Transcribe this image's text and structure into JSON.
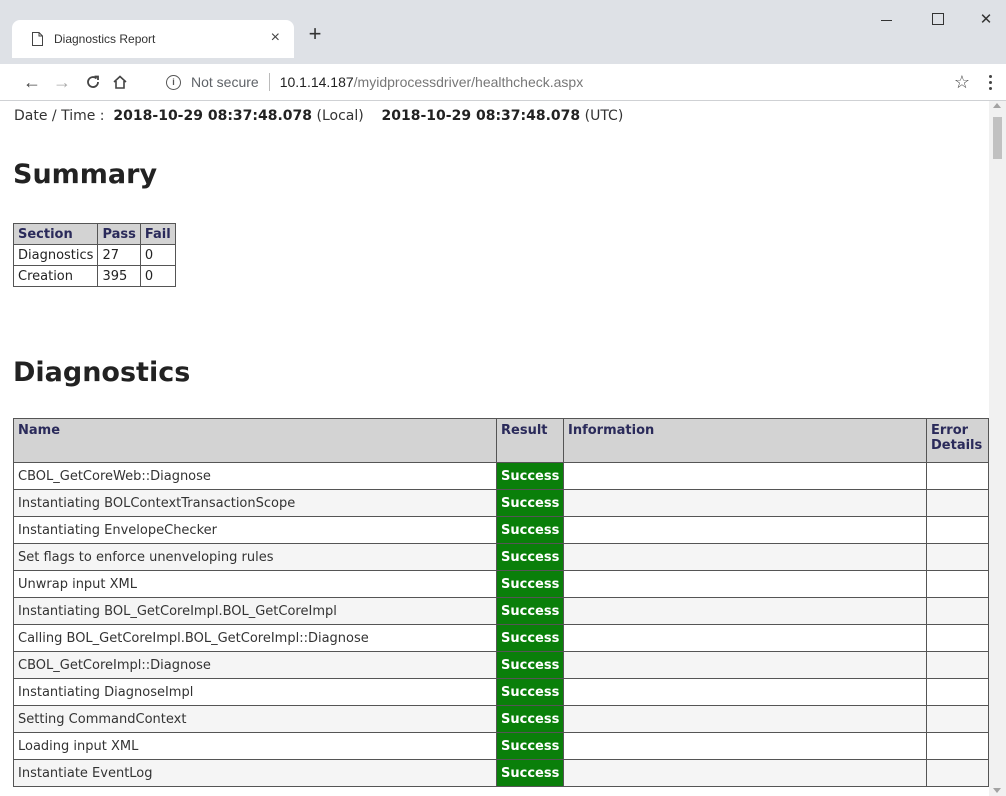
{
  "browser": {
    "tab_title": "Diagnostics Report",
    "tab_close": "×",
    "new_tab": "+",
    "address": {
      "security_label": "Not secure",
      "host": "10.1.14.187",
      "path": "/myidprocessdriver/healthcheck.aspx"
    },
    "icons": {
      "back": "←",
      "forward": "→",
      "reload": "C",
      "home": "⌂",
      "star": "☆",
      "close": "✕"
    }
  },
  "page": {
    "datetime": {
      "label": "Date / Time :",
      "local_value": "2018-10-29 08:37:48.078",
      "local_suffix": "(Local)",
      "utc_value": "2018-10-29 08:37:48.078",
      "utc_suffix": "(UTC)"
    },
    "summary": {
      "heading": "Summary",
      "headers": [
        "Section",
        "Pass",
        "Fail"
      ],
      "rows": [
        [
          "Diagnostics",
          "27",
          "0"
        ],
        [
          "Creation",
          "395",
          "0"
        ]
      ]
    },
    "diagnostics": {
      "heading": "Diagnostics",
      "headers": [
        "Name",
        "Result",
        "Information",
        "Error Details"
      ],
      "rows": [
        {
          "name": "CBOL_GetCoreWeb::Diagnose",
          "result": "Success",
          "info": "",
          "error": ""
        },
        {
          "name": "Instantiating BOLContextTransactionScope",
          "result": "Success",
          "info": "",
          "error": ""
        },
        {
          "name": "Instantiating EnvelopeChecker",
          "result": "Success",
          "info": "",
          "error": ""
        },
        {
          "name": "Set flags to enforce unenveloping rules",
          "result": "Success",
          "info": "",
          "error": ""
        },
        {
          "name": "Unwrap input XML",
          "result": "Success",
          "info": "",
          "error": ""
        },
        {
          "name": "Instantiating BOL_GetCoreImpl.BOL_GetCoreImpl",
          "result": "Success",
          "info": "",
          "error": ""
        },
        {
          "name": "Calling BOL_GetCoreImpl.BOL_GetCoreImpl::Diagnose",
          "result": "Success",
          "info": "",
          "error": ""
        },
        {
          "name": "CBOL_GetCoreImpl::Diagnose",
          "result": "Success",
          "info": "",
          "error": ""
        },
        {
          "name": "Instantiating DiagnoseImpl",
          "result": "Success",
          "info": "",
          "error": ""
        },
        {
          "name": "Setting CommandContext",
          "result": "Success",
          "info": "",
          "error": ""
        },
        {
          "name": "Loading input XML",
          "result": "Success",
          "info": "",
          "error": ""
        },
        {
          "name": "Instantiate EventLog",
          "result": "Success",
          "info": "",
          "error": ""
        }
      ]
    },
    "colors": {
      "success_bg": "#0a7f0a",
      "header_bg": "#d3d3d3",
      "header_text": "#2a2a5a"
    }
  }
}
